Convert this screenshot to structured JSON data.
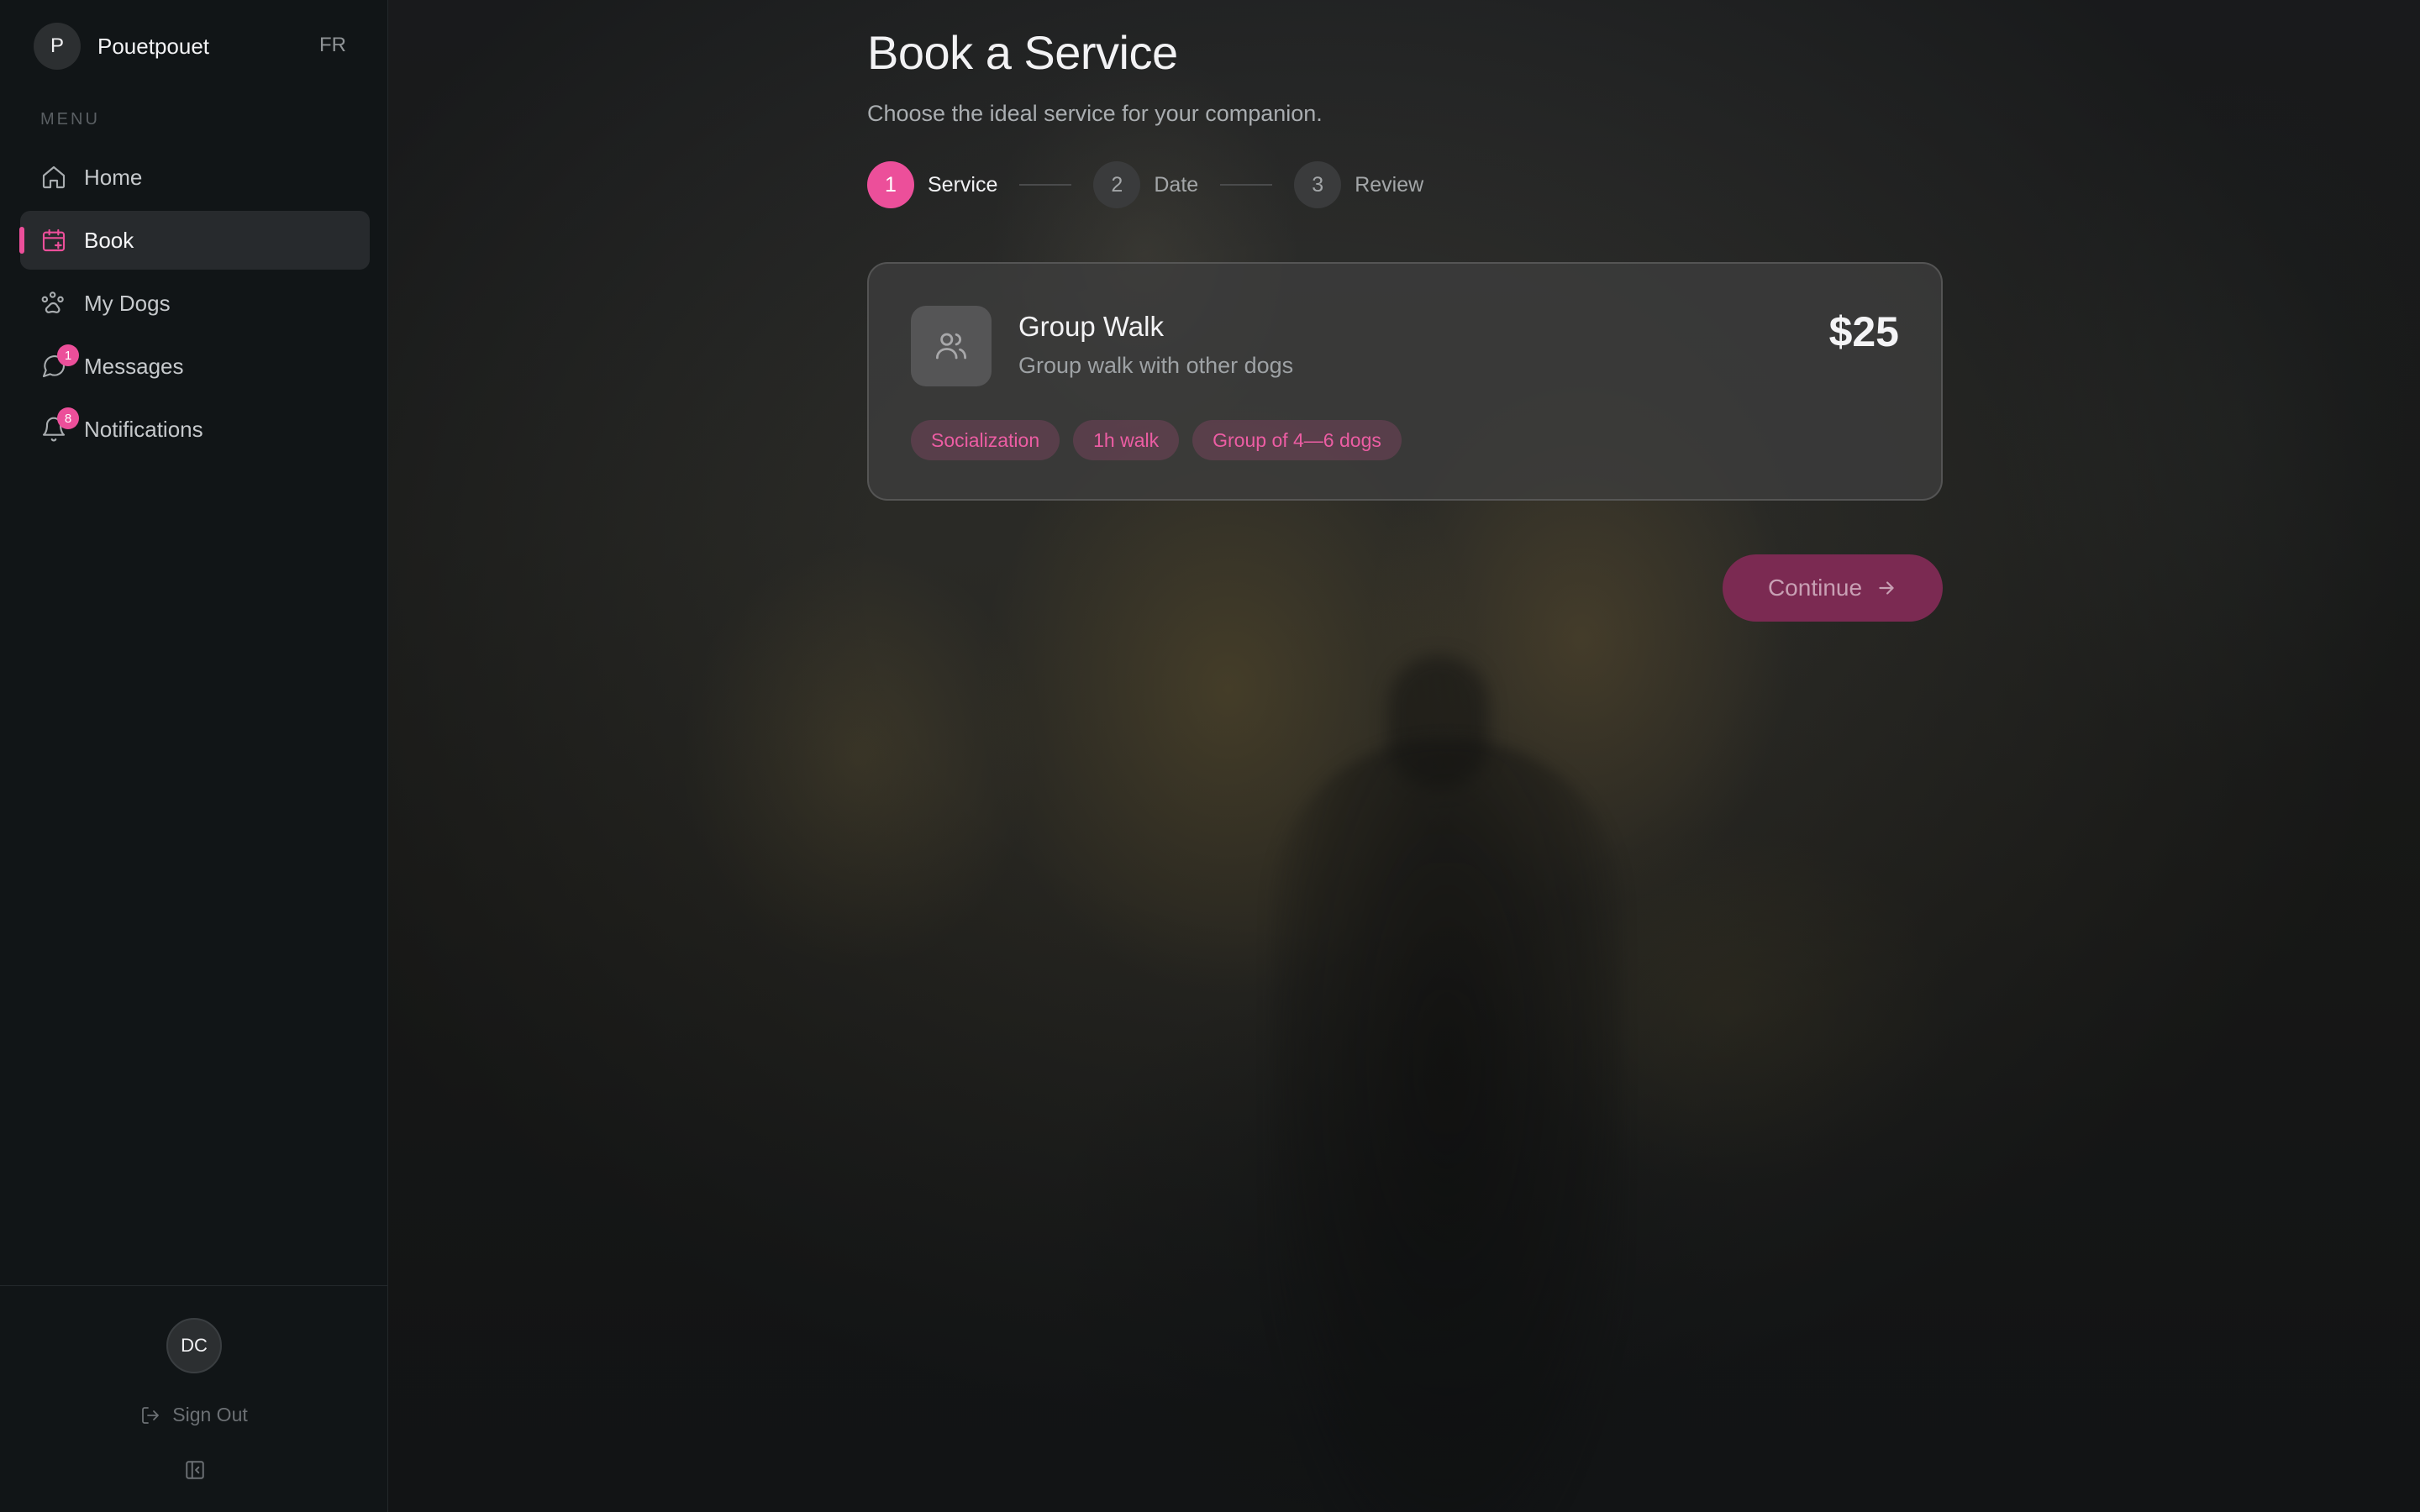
{
  "brand": {
    "initial": "P",
    "name": "Pouetpouet"
  },
  "language": "FR",
  "sidebar": {
    "menu_heading": "MENU",
    "items": [
      {
        "label": "Home",
        "icon": "home-icon",
        "active": false,
        "badge": null
      },
      {
        "label": "Book",
        "icon": "calendar-plus-icon",
        "active": true,
        "badge": null
      },
      {
        "label": "My Dogs",
        "icon": "paw-icon",
        "active": false,
        "badge": null
      },
      {
        "label": "Messages",
        "icon": "message-icon",
        "active": false,
        "badge": "1"
      },
      {
        "label": "Notifications",
        "icon": "bell-icon",
        "active": false,
        "badge": "8"
      }
    ]
  },
  "user": {
    "initials": "DC"
  },
  "sign_out_label": "Sign Out",
  "page": {
    "title": "Book a Service",
    "subtitle": "Choose the ideal service for your companion."
  },
  "stepper": {
    "steps": [
      {
        "number": "1",
        "label": "Service",
        "active": true
      },
      {
        "number": "2",
        "label": "Date",
        "active": false
      },
      {
        "number": "3",
        "label": "Review",
        "active": false
      }
    ]
  },
  "service": {
    "name": "Group Walk",
    "description": "Group walk with other dogs",
    "price": "$25",
    "icon": "users-icon",
    "tags": [
      "Socialization",
      "1h walk",
      "Group of 4—6 dogs"
    ]
  },
  "continue_label": "Continue",
  "colors": {
    "accent": "#ec4f9a",
    "sidebar_bg": "#111517",
    "card_bg": "#3e3e3e",
    "continue_bg": "#7b2a52"
  }
}
